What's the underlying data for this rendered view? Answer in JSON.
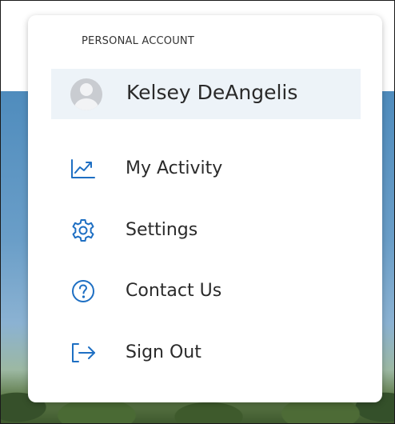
{
  "menu": {
    "section_label": "PERSONAL ACCOUNT",
    "user": {
      "name": "Kelsey DeAngelis",
      "avatar_icon": "user-avatar-icon"
    },
    "items": [
      {
        "label": "My Activity",
        "icon": "activity-chart-icon"
      },
      {
        "label": "Settings",
        "icon": "gear-icon"
      },
      {
        "label": "Contact Us",
        "icon": "question-circle-icon"
      },
      {
        "label": "Sign Out",
        "icon": "sign-out-icon"
      }
    ]
  },
  "colors": {
    "accent": "#1e6fc3",
    "user_row_bg": "#edf3f8",
    "text": "#2a2a2a"
  }
}
